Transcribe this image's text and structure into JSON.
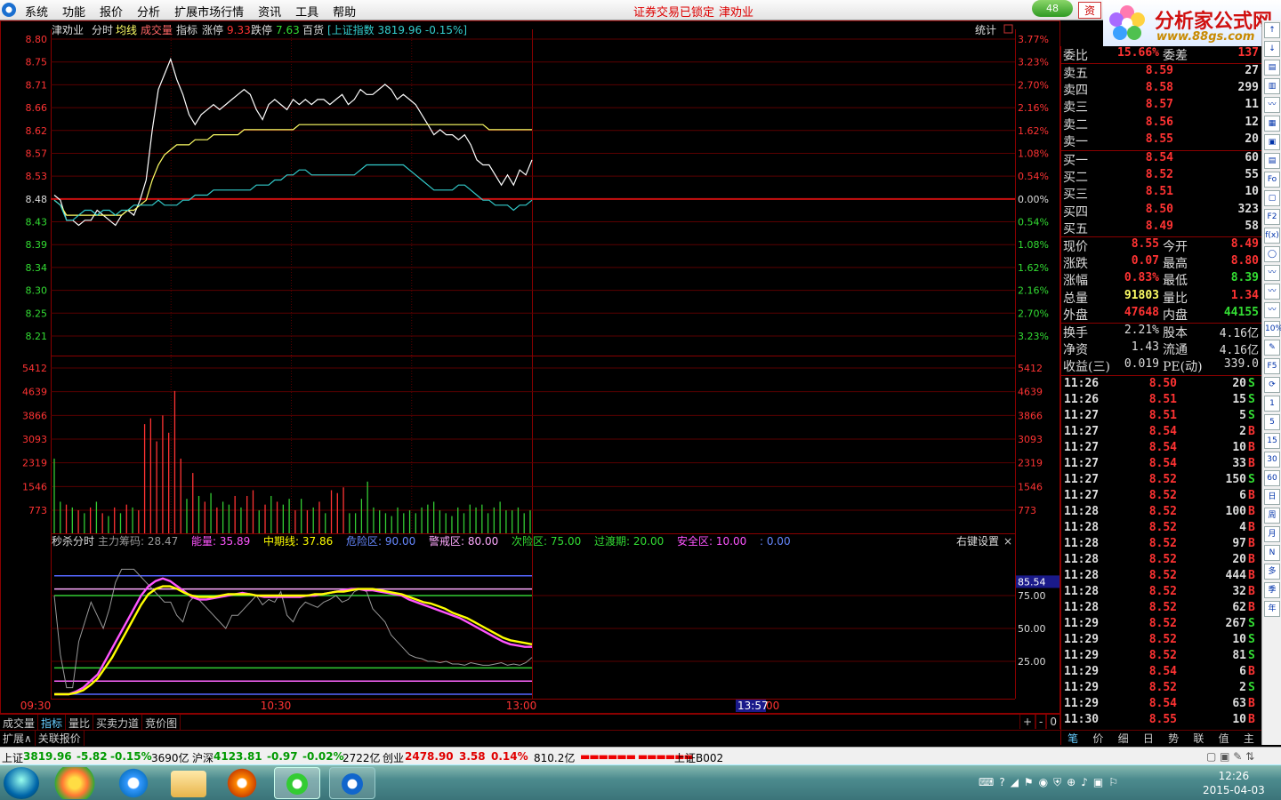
{
  "menu": {
    "items": [
      "系统",
      "功能",
      "报价",
      "分析",
      "扩展市场行情",
      "资讯",
      "工具",
      "帮助"
    ],
    "lock_message": "证券交易已锁定",
    "stock_name": "津劝业",
    "badge": "48",
    "zi_button": "资"
  },
  "brand": {
    "title": "分析家公式网",
    "url": "www.88gs.com"
  },
  "chart_header": {
    "stock": "津劝业",
    "tab_fenshi": "分时",
    "tab_junxian": "均线",
    "tab_chengjiao": "成交量",
    "tab_zhibiao": "指标",
    "zhangting_label": "涨停",
    "zhangting_value": "9.33",
    "dieting_label": "跌停",
    "dieting_value": "7.63",
    "sector": "百货",
    "index_info": "[上证指数 3819.96 -0.15%]",
    "stats_label": "统计"
  },
  "indicator_header": {
    "name": "秒杀分时",
    "items": [
      {
        "label": "主力筹码:",
        "value": "28.47",
        "color": "#999999"
      },
      {
        "label": "能量:",
        "value": "35.89",
        "color": "#ff55ff"
      },
      {
        "label": "中期线:",
        "value": "37.86",
        "color": "#ffff00"
      },
      {
        "label": "危险区:",
        "value": "90.00",
        "color": "#6688ff"
      },
      {
        "label": "警戒区:",
        "value": "80.00",
        "color": "#ffaaff"
      },
      {
        "label": "次险区:",
        "value": "75.00",
        "color": "#33dd33"
      },
      {
        "label": "过渡期:",
        "value": "20.00",
        "color": "#33dd33"
      },
      {
        "label": "安全区:",
        "value": "10.00",
        "color": "#ff55ff"
      },
      {
        "label": ":",
        "value": "0.00",
        "color": "#6688ff"
      }
    ],
    "right_settings": "右键设置"
  },
  "x_axis": {
    "labels": [
      "09:30",
      "10:30",
      "13:00"
    ],
    "cursor_time": "13:57",
    "cursor_suffix": "00"
  },
  "chart_data": [
    {
      "type": "line",
      "title": "津劝业 分时",
      "y_price_ticks": [
        "8.80",
        "8.75",
        "8.71",
        "8.66",
        "8.62",
        "8.57",
        "8.53",
        "8.48",
        "8.43",
        "8.39",
        "8.34",
        "8.30",
        "8.25",
        "8.21"
      ],
      "y_pct_ticks": [
        "3.77%",
        "3.23%",
        "2.70%",
        "2.16%",
        "1.62%",
        "1.08%",
        "0.54%",
        "0.00%",
        "0.54%",
        "1.08%",
        "1.62%",
        "2.16%",
        "2.70%",
        "3.23%"
      ],
      "ylim": [
        8.19,
        8.8
      ],
      "base_price": 8.48,
      "series": [
        {
          "name": "价格",
          "color": "#ffffff",
          "values": [
            8.49,
            8.48,
            8.44,
            8.44,
            8.43,
            8.44,
            8.44,
            8.46,
            8.45,
            8.44,
            8.43,
            8.45,
            8.46,
            8.45,
            8.48,
            8.52,
            8.62,
            8.7,
            8.73,
            8.76,
            8.72,
            8.69,
            8.65,
            8.63,
            8.65,
            8.66,
            8.67,
            8.66,
            8.67,
            8.68,
            8.69,
            8.7,
            8.69,
            8.66,
            8.64,
            8.67,
            8.68,
            8.67,
            8.66,
            8.68,
            8.67,
            8.68,
            8.67,
            8.68,
            8.68,
            8.67,
            8.68,
            8.69,
            8.67,
            8.68,
            8.7,
            8.69,
            8.69,
            8.7,
            8.71,
            8.7,
            8.68,
            8.69,
            8.68,
            8.67,
            8.65,
            8.63,
            8.61,
            8.62,
            8.61,
            8.61,
            8.6,
            8.61,
            8.59,
            8.56,
            8.55,
            8.55,
            8.53,
            8.51,
            8.53,
            8.51,
            8.54,
            8.53,
            8.56
          ]
        },
        {
          "name": "均价",
          "color": "#ffff66",
          "values": [
            8.48,
            8.47,
            8.45,
            8.45,
            8.45,
            8.45,
            8.45,
            8.45,
            8.45,
            8.45,
            8.45,
            8.45,
            8.46,
            8.46,
            8.47,
            8.48,
            8.52,
            8.55,
            8.57,
            8.58,
            8.59,
            8.59,
            8.59,
            8.6,
            8.6,
            8.6,
            8.61,
            8.61,
            8.61,
            8.61,
            8.61,
            8.62,
            8.62,
            8.62,
            8.62,
            8.62,
            8.62,
            8.62,
            8.62,
            8.62,
            8.63,
            8.63,
            8.63,
            8.63,
            8.63,
            8.63,
            8.63,
            8.63,
            8.63,
            8.63,
            8.63,
            8.63,
            8.63,
            8.63,
            8.63,
            8.63,
            8.63,
            8.63,
            8.63,
            8.63,
            8.63,
            8.63,
            8.63,
            8.63,
            8.63,
            8.63,
            8.63,
            8.63,
            8.63,
            8.63,
            8.63,
            8.62,
            8.62,
            8.62,
            8.62,
            8.62,
            8.62,
            8.62,
            8.62
          ]
        },
        {
          "name": "上证指数",
          "color": "#33cccc",
          "values": [
            8.48,
            8.47,
            8.44,
            8.44,
            8.45,
            8.46,
            8.46,
            8.45,
            8.46,
            8.46,
            8.45,
            8.46,
            8.46,
            8.47,
            8.47,
            8.47,
            8.47,
            8.48,
            8.47,
            8.47,
            8.47,
            8.48,
            8.48,
            8.49,
            8.49,
            8.49,
            8.5,
            8.5,
            8.5,
            8.5,
            8.5,
            8.5,
            8.5,
            8.51,
            8.51,
            8.51,
            8.52,
            8.52,
            8.53,
            8.53,
            8.54,
            8.54,
            8.53,
            8.53,
            8.53,
            8.53,
            8.53,
            8.53,
            8.53,
            8.53,
            8.54,
            8.55,
            8.55,
            8.55,
            8.55,
            8.55,
            8.55,
            8.55,
            8.54,
            8.53,
            8.52,
            8.51,
            8.5,
            8.5,
            8.5,
            8.5,
            8.51,
            8.51,
            8.5,
            8.49,
            8.48,
            8.48,
            8.47,
            8.47,
            8.47,
            8.46,
            8.47,
            8.47,
            8.48
          ]
        }
      ]
    },
    {
      "type": "bar",
      "title": "成交量",
      "y_ticks": [
        "5412",
        "4639",
        "3866",
        "3093",
        "2319",
        "1546",
        "773"
      ],
      "ylim": [
        0,
        6185
      ],
      "up_color": "#ff3333",
      "down_color": "#33cc33",
      "values": [
        2600,
        1100,
        1000,
        900,
        800,
        700,
        900,
        1100,
        700,
        600,
        900,
        700,
        1000,
        900,
        800,
        3800,
        4000,
        3200,
        4100,
        3500,
        4950,
        2600,
        1200,
        2100,
        1300,
        1100,
        1400,
        900,
        1100,
        1000,
        1300,
        900,
        1300,
        1500,
        800,
        1000,
        1300,
        1100,
        1000,
        1200,
        800,
        1200,
        800,
        900,
        1100,
        700,
        1500,
        1400,
        1600,
        700,
        700,
        1200,
        1800,
        900,
        800,
        700,
        600,
        900,
        700,
        800,
        700,
        900,
        1000,
        1100,
        800,
        700,
        600,
        900,
        700,
        1000,
        900,
        1000,
        700,
        900,
        1100,
        800,
        800,
        900,
        700,
        800
      ],
      "colors": [
        "d",
        "d",
        "u",
        "d",
        "u",
        "d",
        "u",
        "d",
        "u",
        "d",
        "u",
        "d",
        "u",
        "d",
        "u",
        "u",
        "u",
        "u",
        "u",
        "u",
        "u",
        "u",
        "d",
        "u",
        "d",
        "u",
        "d",
        "u",
        "d",
        "d",
        "u",
        "d",
        "u",
        "u",
        "d",
        "u",
        "d",
        "u",
        "d",
        "d",
        "u",
        "d",
        "u",
        "d",
        "u",
        "d",
        "u",
        "u",
        "u",
        "d",
        "d",
        "d",
        "d",
        "d",
        "d",
        "d",
        "d",
        "d",
        "d",
        "d",
        "d",
        "d",
        "d",
        "d",
        "d",
        "d",
        "d",
        "d",
        "d",
        "d",
        "d",
        "d",
        "d",
        "d",
        "d",
        "d",
        "d",
        "d",
        "d"
      ]
    },
    {
      "type": "line",
      "title": "秒杀分时",
      "y_ticks": [
        "75.00",
        "50.00",
        "25.00"
      ],
      "current_value_label": "85.54",
      "ylim": [
        0,
        100
      ],
      "reference_lines": [
        {
          "value": 90,
          "color": "#5566ff"
        },
        {
          "value": 80,
          "color": "#ffaaff"
        },
        {
          "value": 75,
          "color": "#33cc33"
        },
        {
          "value": 20,
          "color": "#33cc33"
        },
        {
          "value": 10,
          "color": "#ff66ff"
        },
        {
          "value": 0,
          "color": "#5566ff"
        }
      ],
      "series": [
        {
          "name": "主力筹码",
          "color": "#999999",
          "values": [
            75,
            30,
            5,
            5,
            40,
            55,
            70,
            60,
            50,
            65,
            85,
            95,
            95,
            95,
            90,
            85,
            80,
            75,
            70,
            70,
            60,
            55,
            70,
            75,
            70,
            65,
            60,
            55,
            50,
            60,
            60,
            65,
            70,
            75,
            68,
            72,
            70,
            78,
            60,
            55,
            65,
            70,
            68,
            66,
            70,
            72,
            75,
            70,
            72,
            78,
            80,
            78,
            65,
            60,
            55,
            45,
            40,
            35,
            30,
            28,
            27,
            25,
            25,
            24,
            25,
            23,
            23,
            22,
            24,
            23,
            22,
            22,
            23,
            24,
            22,
            23,
            22,
            24,
            28
          ]
        },
        {
          "name": "能量",
          "color": "#ff55ff",
          "values": [
            0,
            0,
            0,
            2,
            5,
            10,
            15,
            25,
            35,
            45,
            55,
            65,
            75,
            82,
            86,
            88,
            86,
            82,
            78,
            74,
            72,
            72,
            73,
            74,
            75,
            76,
            77,
            76,
            75,
            74,
            74,
            74,
            74,
            74,
            74,
            75,
            75,
            76,
            77,
            78,
            79,
            80,
            80,
            79,
            79,
            78,
            77,
            76,
            75,
            72,
            70,
            68,
            66,
            64,
            62,
            60,
            58,
            55,
            52,
            49,
            46,
            43,
            40,
            38,
            37,
            36,
            36
          ]
        },
        {
          "name": "中期线",
          "color": "#ffff00",
          "values": [
            0,
            0,
            0,
            1,
            3,
            7,
            12,
            20,
            28,
            38,
            48,
            58,
            68,
            76,
            80,
            82,
            82,
            80,
            77,
            75,
            74,
            74,
            74,
            75,
            76,
            76,
            76,
            76,
            75,
            75,
            75,
            75,
            75,
            75,
            75,
            75,
            76,
            76,
            77,
            78,
            78,
            79,
            80,
            80,
            80,
            79,
            78,
            77,
            76,
            74,
            72,
            70,
            69,
            67,
            65,
            62,
            60,
            58,
            55,
            52,
            49,
            46,
            43,
            41,
            40,
            39,
            38
          ]
        }
      ]
    }
  ],
  "bottom_tabs": [
    "成交量",
    "指标",
    "量比",
    "买卖力道",
    "竞价图"
  ],
  "bottom_tabs_active": "指标",
  "bottom_controls": [
    "+",
    "-",
    "0"
  ],
  "sub_tabs": [
    "扩展∧",
    "关联报价"
  ],
  "right_tabs": [
    "笔",
    "价",
    "细",
    "日",
    "势",
    "联",
    "值",
    "主"
  ],
  "right_tabs_active": "笔",
  "weibi": {
    "label": "委比",
    "value": "15.66%",
    "label2": "委差",
    "value2": "137"
  },
  "sell_orders": [
    {
      "label": "卖五",
      "price": "8.59",
      "vol": "27"
    },
    {
      "label": "卖四",
      "price": "8.58",
      "vol": "299"
    },
    {
      "label": "卖三",
      "price": "8.57",
      "vol": "11"
    },
    {
      "label": "卖二",
      "price": "8.56",
      "vol": "12"
    },
    {
      "label": "卖一",
      "price": "8.55",
      "vol": "20"
    }
  ],
  "buy_orders": [
    {
      "label": "买一",
      "price": "8.54",
      "vol": "60"
    },
    {
      "label": "买二",
      "price": "8.52",
      "vol": "55"
    },
    {
      "label": "买三",
      "price": "8.51",
      "vol": "10"
    },
    {
      "label": "买四",
      "price": "8.50",
      "vol": "323"
    },
    {
      "label": "买五",
      "price": "8.49",
      "vol": "58"
    }
  ],
  "quote_stats": [
    {
      "l1": "现价",
      "v1": "8.55",
      "c1": "#ff3333",
      "l2": "今开",
      "v2": "8.49",
      "c2": "#ff3333"
    },
    {
      "l1": "涨跌",
      "v1": "0.07",
      "c1": "#ff3333",
      "l2": "最高",
      "v2": "8.80",
      "c2": "#ff3333"
    },
    {
      "l1": "涨幅",
      "v1": "0.83%",
      "c1": "#ff3333",
      "l2": "最低",
      "v2": "8.39",
      "c2": "#33dd33"
    },
    {
      "l1": "总量",
      "v1": "91803",
      "c1": "#ffff66",
      "l2": "量比",
      "v2": "1.34",
      "c2": "#ff3333"
    },
    {
      "l1": "外盘",
      "v1": "47648",
      "c1": "#ff3333",
      "l2": "内盘",
      "v2": "44155",
      "c2": "#33dd33"
    }
  ],
  "fund_stats": [
    {
      "l1": "换手",
      "v1": "2.21%",
      "l2": "股本",
      "v2": "4.16亿"
    },
    {
      "l1": "净资",
      "v1": "1.43",
      "l2": "流通",
      "v2": "4.16亿"
    },
    {
      "l1": "收益(三)",
      "v1": "0.019",
      "l2": "PE(动)",
      "v2": "339.0"
    }
  ],
  "ticks": [
    {
      "time": "11:26",
      "price": "8.50",
      "vol": "20",
      "bs": "S"
    },
    {
      "time": "11:26",
      "price": "8.51",
      "vol": "15",
      "bs": "S"
    },
    {
      "time": "11:27",
      "price": "8.51",
      "vol": "5",
      "bs": "S"
    },
    {
      "time": "11:27",
      "price": "8.54",
      "vol": "2",
      "bs": "B"
    },
    {
      "time": "11:27",
      "price": "8.54",
      "vol": "10",
      "bs": "B"
    },
    {
      "time": "11:27",
      "price": "8.54",
      "vol": "33",
      "bs": "B"
    },
    {
      "time": "11:27",
      "price": "8.52",
      "vol": "150",
      "bs": "S"
    },
    {
      "time": "11:27",
      "price": "8.52",
      "vol": "6",
      "bs": "B"
    },
    {
      "time": "11:28",
      "price": "8.52",
      "vol": "100",
      "bs": "B"
    },
    {
      "time": "11:28",
      "price": "8.52",
      "vol": "4",
      "bs": "B"
    },
    {
      "time": "11:28",
      "price": "8.52",
      "vol": "97",
      "bs": "B"
    },
    {
      "time": "11:28",
      "price": "8.52",
      "vol": "20",
      "bs": "B"
    },
    {
      "time": "11:28",
      "price": "8.52",
      "vol": "444",
      "bs": "B"
    },
    {
      "time": "11:28",
      "price": "8.52",
      "vol": "32",
      "bs": "B"
    },
    {
      "time": "11:28",
      "price": "8.52",
      "vol": "62",
      "bs": "B"
    },
    {
      "time": "11:29",
      "price": "8.52",
      "vol": "267",
      "bs": "S"
    },
    {
      "time": "11:29",
      "price": "8.52",
      "vol": "10",
      "bs": "S"
    },
    {
      "time": "11:29",
      "price": "8.52",
      "vol": "81",
      "bs": "S"
    },
    {
      "time": "11:29",
      "price": "8.54",
      "vol": "6",
      "bs": "B"
    },
    {
      "time": "11:29",
      "price": "8.52",
      "vol": "2",
      "bs": "S"
    },
    {
      "time": "11:29",
      "price": "8.54",
      "vol": "63",
      "bs": "B"
    },
    {
      "time": "11:30",
      "price": "8.55",
      "vol": "10",
      "bs": "B"
    }
  ],
  "right_icons": [
    "↑",
    "↓",
    "▤",
    "▥",
    "〰",
    "▦",
    "▣",
    "▤",
    "Fo",
    "▢",
    "F2",
    "f(x)",
    "◯",
    "〰",
    "〰",
    "〰",
    "10%",
    "✎",
    "F5",
    "⟳",
    "1",
    "5",
    "15",
    "30",
    "60",
    "日",
    "周",
    "月",
    "N",
    "多",
    "季",
    "年"
  ],
  "statusbar": {
    "sh_label": "上证",
    "sh_value": "3819.96",
    "sh_change": "-5.82",
    "sh_pct": "-0.15%",
    "sh_amount": "3690亿",
    "hs_label": "沪深",
    "hs_value": "4123.81",
    "hs_change": "-0.97",
    "hs_pct": "-0.02%",
    "hs_amount": "2722亿",
    "cy_label": "创业",
    "cy_value": "2478.90",
    "cy_change": "3.58",
    "cy_pct": "0.14%",
    "cy_amount": "810.2亿",
    "ticker": "上证B002"
  },
  "taskbar": {
    "time": "12:26",
    "date": "2015-04-03"
  }
}
